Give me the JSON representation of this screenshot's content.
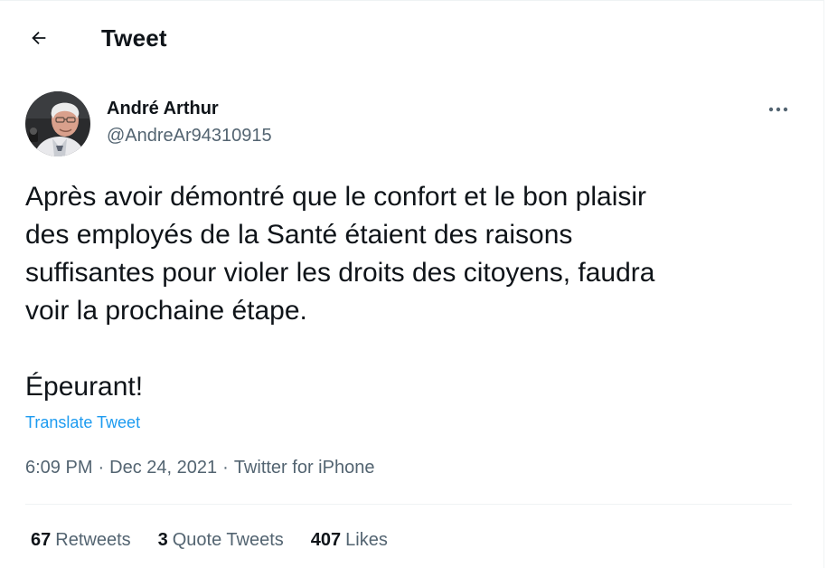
{
  "header": {
    "back_icon": "arrow-left-icon",
    "title": "Tweet"
  },
  "author": {
    "display_name": "André Arthur",
    "handle": "@AndreAr94310915",
    "avatar_icon": "profile-photo"
  },
  "more_icon": "more-horizontal-icon",
  "tweet": {
    "text": "Après avoir démontré que le confort et le bon plaisir\ndes employés de la Santé étaient des raisons\nsuffisantes pour violer les droits des citoyens, faudra\nvoir la prochaine étape.\n\nÉpeurant!",
    "translate_label": "Translate Tweet"
  },
  "meta": {
    "time": "6:09 PM",
    "separator": "·",
    "date": "Dec 24, 2021",
    "source": "Twitter for iPhone"
  },
  "stats": {
    "retweets_count": "67",
    "retweets_label": "Retweets",
    "quotes_count": "3",
    "quotes_label": "Quote Tweets",
    "likes_count": "407",
    "likes_label": "Likes"
  },
  "colors": {
    "text": "#0f1419",
    "secondary": "#536471",
    "link": "#1d9bf0",
    "border": "#eff3f4"
  }
}
